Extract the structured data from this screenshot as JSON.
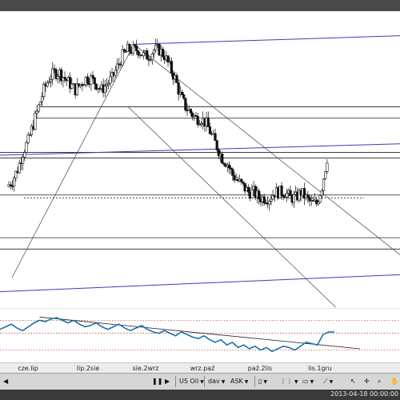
{
  "chart_data": [
    {
      "type": "candlestick",
      "x_tick_labels": [
        "cze.lip",
        "lip.2sie",
        "sie.2wrz",
        "wrz.paź",
        "paź.2lis",
        "lis.1gru"
      ],
      "price_path": [
        72,
        73,
        75,
        78,
        80,
        83,
        86,
        89,
        91,
        92,
        92,
        91,
        90,
        89,
        90,
        91,
        91,
        90,
        89,
        90,
        91,
        93,
        95,
        96,
        96,
        96,
        95,
        95,
        96,
        96,
        95,
        93,
        91,
        88,
        86,
        85,
        84,
        84,
        83,
        81,
        79,
        77,
        76,
        74,
        73,
        72,
        71,
        71,
        70,
        70,
        70,
        71,
        71,
        71,
        70,
        70,
        71,
        70,
        69,
        69,
        72,
        77
      ],
      "horizontal_levels": [
        86,
        84,
        78,
        77,
        70.5,
        63,
        61
      ],
      "support_line_dotted": 70
    },
    {
      "type": "line",
      "name": "oscillator",
      "values": [
        48,
        50,
        52,
        49,
        47,
        50,
        53,
        55,
        54,
        56,
        57,
        55,
        53,
        55,
        52,
        50,
        51,
        53,
        50,
        48,
        50,
        52,
        49,
        47,
        49,
        51,
        48,
        46,
        45,
        47,
        45,
        43,
        46,
        44,
        42,
        41,
        43,
        40,
        38,
        40,
        36,
        38,
        34,
        36,
        33,
        35,
        32,
        34,
        31,
        33,
        35,
        34,
        32,
        35,
        38,
        37,
        36,
        44,
        46,
        46
      ],
      "dotted_levels": [
        55,
        45,
        32
      ]
    }
  ],
  "toolbar": {
    "instrument": "US Oil",
    "timeframe": "dav",
    "price_side": "ASK"
  },
  "status": {
    "timestamp": "2013-04-18 00:00:00"
  },
  "colors": {
    "candle": "#101010",
    "trend_blue": "#3c3cb4",
    "level_line": "#222222",
    "oscillator": "#1a72a8",
    "dotted_red": "#c85050"
  }
}
